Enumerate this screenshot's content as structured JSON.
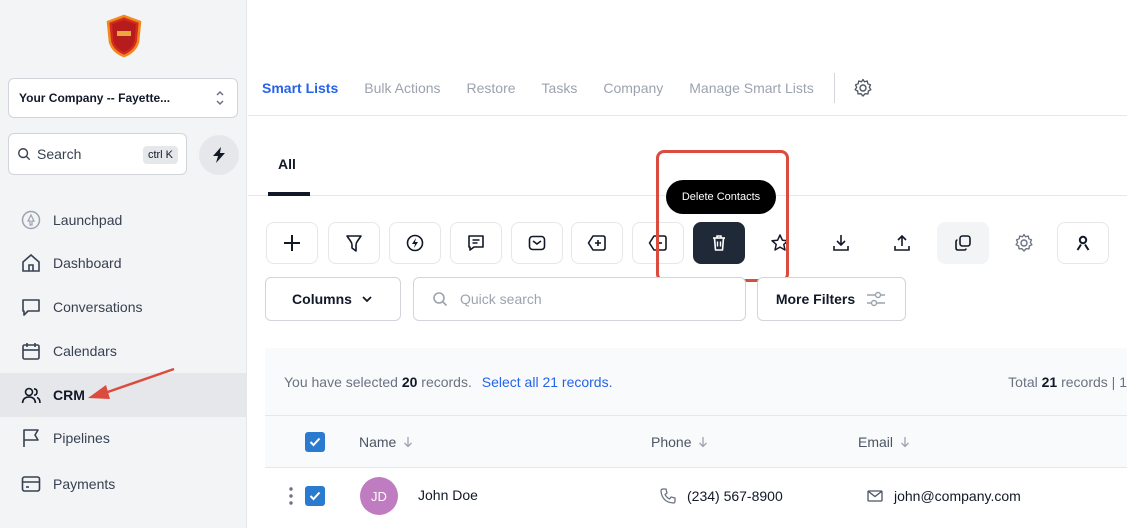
{
  "sidebar": {
    "company": "Your Company -- Fayette...",
    "search": {
      "label": "Search",
      "shortcut": "ctrl K"
    },
    "nav": [
      {
        "label": "Launchpad"
      },
      {
        "label": "Dashboard"
      },
      {
        "label": "Conversations"
      },
      {
        "label": "Calendars"
      },
      {
        "label": "CRM"
      },
      {
        "label": "Pipelines"
      },
      {
        "label": "Payments"
      }
    ],
    "active_item": "CRM"
  },
  "top_nav": {
    "tabs": [
      {
        "label": "Smart Lists"
      },
      {
        "label": "Bulk Actions"
      },
      {
        "label": "Restore"
      },
      {
        "label": "Tasks"
      },
      {
        "label": "Company"
      },
      {
        "label": "Manage Smart Lists"
      }
    ],
    "active_tab": "Smart Lists"
  },
  "sub_tabs": {
    "all": "All"
  },
  "toolbar": {
    "tooltip": "Delete Contacts",
    "icons": [
      "plus-icon",
      "filter-icon",
      "workflow-icon",
      "message-icon",
      "mail-icon",
      "add-tag-icon",
      "remove-tag-icon",
      "trash-icon",
      "star-icon",
      "download-icon",
      "upload-icon",
      "merge-icon",
      "settings-icon",
      "person-icon"
    ]
  },
  "filters": {
    "columns": "Columns",
    "quick_search_placeholder": "Quick search",
    "more_filters": "More Filters"
  },
  "table": {
    "selection": {
      "prefix": "You have selected",
      "count": "20",
      "suffix": "records.",
      "select_all": "Select all 21 records.",
      "total_prefix": "Total",
      "total": "21",
      "total_suffix": "records | 1"
    },
    "headers": {
      "name": "Name",
      "phone": "Phone",
      "email": "Email"
    },
    "rows": [
      {
        "initials": "JD",
        "name": "John Doe",
        "phone": "(234) 567-8900",
        "email": "john@company.com"
      }
    ]
  },
  "colors": {
    "accent": "#2563eb",
    "checkbox": "#2a7bd0",
    "avatar": "#c07cc0",
    "highlight": "#dc4c3e"
  }
}
